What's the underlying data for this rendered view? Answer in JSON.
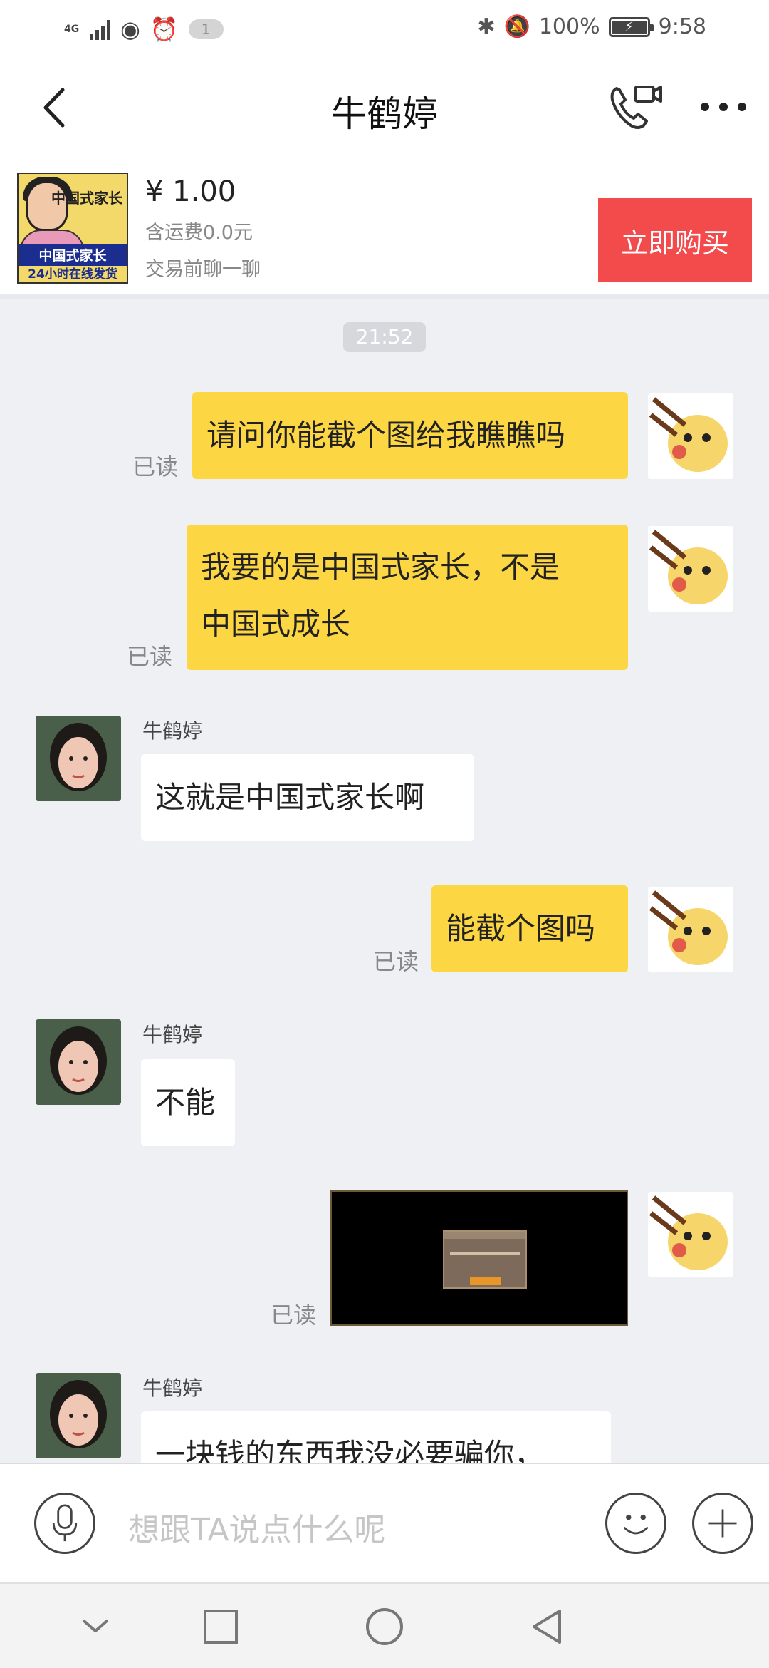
{
  "status_bar": {
    "network": "4G",
    "notification_count": "1",
    "battery": "100%",
    "time": "9:58"
  },
  "header": {
    "title": "牛鹤婷"
  },
  "product": {
    "thumb_title": "中国式家长",
    "thumb_line1": "中国式家长",
    "thumb_line2": "24小时在线发货",
    "price": "¥ 1.00",
    "shipping": "含运费0.0元",
    "prompt": "交易前聊一聊",
    "buy_label": "立即购买"
  },
  "chat": {
    "timestamp": "21:52",
    "read_label": "已读",
    "messages": [
      {
        "from": "me",
        "text": "请问你能截个图给我瞧瞧吗",
        "status": "已读"
      },
      {
        "from": "me",
        "text_line1": "我要的是中国式家长，不是",
        "text_line2": "中国式成长",
        "status": "已读"
      },
      {
        "from": "other",
        "sender": "牛鹤婷",
        "text": "这就是中国式家长啊"
      },
      {
        "from": "me",
        "text": "能截个图吗",
        "status": "已读"
      },
      {
        "from": "other",
        "sender": "牛鹤婷",
        "text": "不能"
      },
      {
        "from": "me",
        "type": "image",
        "status": "已读"
      },
      {
        "from": "other",
        "sender": "牛鹤婷",
        "text": "一块钱的东西我没必要骗你，"
      }
    ]
  },
  "input": {
    "placeholder": "想跟TA说点什么呢"
  },
  "colors": {
    "accent_yellow": "#fdd644",
    "buy_red": "#f34a4c",
    "background": "#eff0f4"
  },
  "icons": [
    "back-icon",
    "video-call-icon",
    "more-icon",
    "mic-icon",
    "emoji-icon",
    "plus-icon",
    "nav-down-icon",
    "nav-recent-icon",
    "nav-home-icon",
    "nav-back-icon"
  ]
}
